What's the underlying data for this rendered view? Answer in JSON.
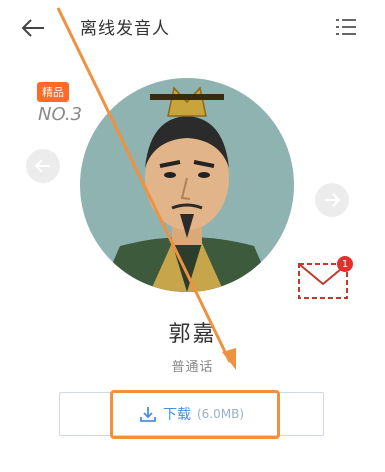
{
  "header": {
    "title": "离线发音人"
  },
  "speaker": {
    "badge": "精品",
    "rank": "NO.3",
    "name": "郭嘉",
    "dialect": "普通话"
  },
  "download": {
    "label": "下载",
    "size": "(6.0MB)"
  },
  "notification": {
    "count": "1"
  },
  "colors": {
    "accent_orange": "#ff6a28",
    "annotation_orange": "#f0913f",
    "link_blue": "#4a90e2",
    "mail_red": "#c0392b"
  }
}
